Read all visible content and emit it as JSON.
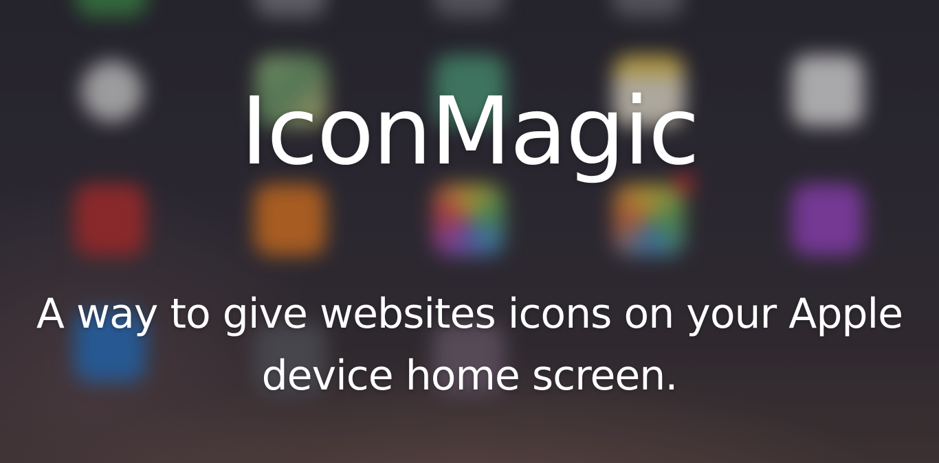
{
  "hero": {
    "title": "IconMagic",
    "tagline": "A way to give websites icons on your Apple device home screen."
  },
  "background": {
    "description_icons": [
      {
        "name": "settings-app-icon",
        "color": "#d8d8d8"
      },
      {
        "name": "maps-app-icon",
        "color": "#8aa87a"
      },
      {
        "name": "facetime-app-icon",
        "color": "#5aa080"
      },
      {
        "name": "notes-app-icon",
        "color": "#e0c860"
      },
      {
        "name": "reminders-app-icon",
        "color": "#e8e8e8"
      },
      {
        "name": "photo-booth-app-icon",
        "color": "#c43a3a"
      },
      {
        "name": "ibooks-app-icon",
        "color": "#e0862c"
      },
      {
        "name": "game-center-app-icon",
        "color": "#4aa0d0"
      },
      {
        "name": "photos-app-icon",
        "color": "#60b060"
      },
      {
        "name": "podcasts-app-icon",
        "color": "#a050c8"
      },
      {
        "name": "appstore-app-icon",
        "color": "#3080d0"
      }
    ]
  }
}
